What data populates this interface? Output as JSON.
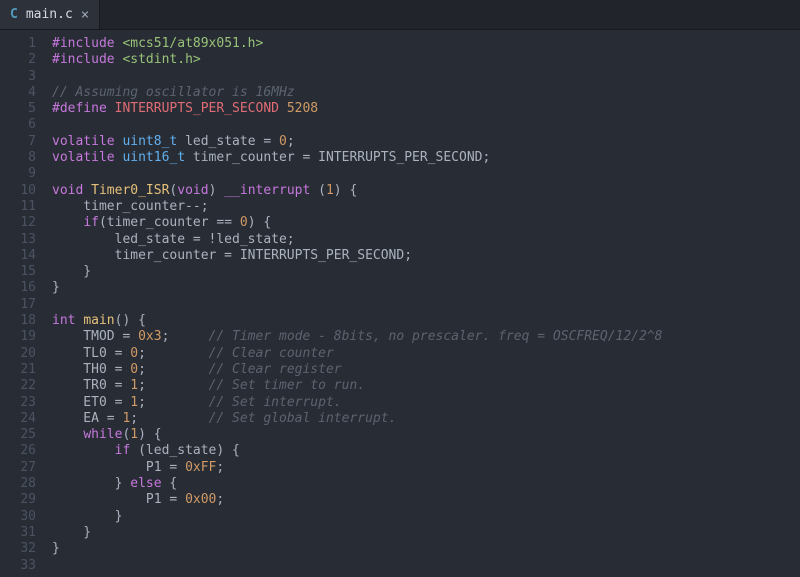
{
  "tab": {
    "lang_icon": "C",
    "filename": "main.c",
    "close_glyph": "×"
  },
  "gutter": {
    "start": 1,
    "count": 33
  },
  "code": {
    "lines": [
      [
        [
          "tk-pp",
          "#include"
        ],
        [
          "tk-plain",
          " "
        ],
        [
          "tk-inc",
          "<mcs51/at89x051.h>"
        ]
      ],
      [
        [
          "tk-pp",
          "#include"
        ],
        [
          "tk-plain",
          " "
        ],
        [
          "tk-inc",
          "<stdint.h>"
        ]
      ],
      [],
      [
        [
          "tk-cm",
          "// Assuming oscillator is 16MHz"
        ]
      ],
      [
        [
          "tk-pp",
          "#define"
        ],
        [
          "tk-plain",
          " "
        ],
        [
          "tk-macro",
          "INTERRUPTS_PER_SECOND"
        ],
        [
          "tk-plain",
          " "
        ],
        [
          "tk-num",
          "5208"
        ]
      ],
      [],
      [
        [
          "tk-kw",
          "volatile"
        ],
        [
          "tk-plain",
          " "
        ],
        [
          "tk-type",
          "uint8_t"
        ],
        [
          "tk-plain",
          " led_state = "
        ],
        [
          "tk-num",
          "0"
        ],
        [
          "tk-plain",
          ";"
        ]
      ],
      [
        [
          "tk-kw",
          "volatile"
        ],
        [
          "tk-plain",
          " "
        ],
        [
          "tk-type",
          "uint16_t"
        ],
        [
          "tk-plain",
          " timer_counter = INTERRUPTS_PER_SECOND;"
        ]
      ],
      [],
      [
        [
          "tk-kw",
          "void"
        ],
        [
          "tk-plain",
          " "
        ],
        [
          "tk-fn",
          "Timer0_ISR"
        ],
        [
          "tk-plain",
          "("
        ],
        [
          "tk-kw",
          "void"
        ],
        [
          "tk-plain",
          ") "
        ],
        [
          "tk-kw",
          "__interrupt"
        ],
        [
          "tk-plain",
          " ("
        ],
        [
          "tk-num",
          "1"
        ],
        [
          "tk-plain",
          ") {"
        ]
      ],
      [
        [
          "tk-plain",
          "    timer_counter--;"
        ]
      ],
      [
        [
          "tk-plain",
          "    "
        ],
        [
          "tk-kw",
          "if"
        ],
        [
          "tk-plain",
          "(timer_counter == "
        ],
        [
          "tk-num",
          "0"
        ],
        [
          "tk-plain",
          ") {"
        ]
      ],
      [
        [
          "tk-plain",
          "        led_state = !led_state;"
        ]
      ],
      [
        [
          "tk-plain",
          "        timer_counter = INTERRUPTS_PER_SECOND;"
        ]
      ],
      [
        [
          "tk-plain",
          "    }"
        ]
      ],
      [
        [
          "tk-plain",
          "}"
        ]
      ],
      [],
      [
        [
          "tk-kw",
          "int"
        ],
        [
          "tk-plain",
          " "
        ],
        [
          "tk-fn",
          "main"
        ],
        [
          "tk-plain",
          "() {"
        ]
      ],
      [
        [
          "tk-plain",
          "    TMOD = "
        ],
        [
          "tk-num",
          "0x3"
        ],
        [
          "tk-plain",
          ";     "
        ],
        [
          "tk-cm",
          "// Timer mode - 8bits, no prescaler. freq = OSCFREQ/12/2^8"
        ]
      ],
      [
        [
          "tk-plain",
          "    TL0 = "
        ],
        [
          "tk-num",
          "0"
        ],
        [
          "tk-plain",
          ";        "
        ],
        [
          "tk-cm",
          "// Clear counter"
        ]
      ],
      [
        [
          "tk-plain",
          "    TH0 = "
        ],
        [
          "tk-num",
          "0"
        ],
        [
          "tk-plain",
          ";        "
        ],
        [
          "tk-cm",
          "// Clear register"
        ]
      ],
      [
        [
          "tk-plain",
          "    TR0 = "
        ],
        [
          "tk-num",
          "1"
        ],
        [
          "tk-plain",
          ";        "
        ],
        [
          "tk-cm",
          "// Set timer to run."
        ]
      ],
      [
        [
          "tk-plain",
          "    ET0 = "
        ],
        [
          "tk-num",
          "1"
        ],
        [
          "tk-plain",
          ";        "
        ],
        [
          "tk-cm",
          "// Set interrupt."
        ]
      ],
      [
        [
          "tk-plain",
          "    EA = "
        ],
        [
          "tk-num",
          "1"
        ],
        [
          "tk-plain",
          ";         "
        ],
        [
          "tk-cm",
          "// Set global interrupt."
        ]
      ],
      [
        [
          "tk-plain",
          "    "
        ],
        [
          "tk-kw",
          "while"
        ],
        [
          "tk-plain",
          "("
        ],
        [
          "tk-num",
          "1"
        ],
        [
          "tk-plain",
          ") {"
        ]
      ],
      [
        [
          "tk-plain",
          "        "
        ],
        [
          "tk-kw",
          "if"
        ],
        [
          "tk-plain",
          " (led_state) {"
        ]
      ],
      [
        [
          "tk-plain",
          "            P1 = "
        ],
        [
          "tk-num",
          "0xFF"
        ],
        [
          "tk-plain",
          ";"
        ]
      ],
      [
        [
          "tk-plain",
          "        } "
        ],
        [
          "tk-kw",
          "else"
        ],
        [
          "tk-plain",
          " {"
        ]
      ],
      [
        [
          "tk-plain",
          "            P1 = "
        ],
        [
          "tk-num",
          "0x00"
        ],
        [
          "tk-plain",
          ";"
        ]
      ],
      [
        [
          "tk-plain",
          "        }"
        ]
      ],
      [
        [
          "tk-plain",
          "    }"
        ]
      ],
      [
        [
          "tk-plain",
          "}"
        ]
      ],
      []
    ]
  }
}
